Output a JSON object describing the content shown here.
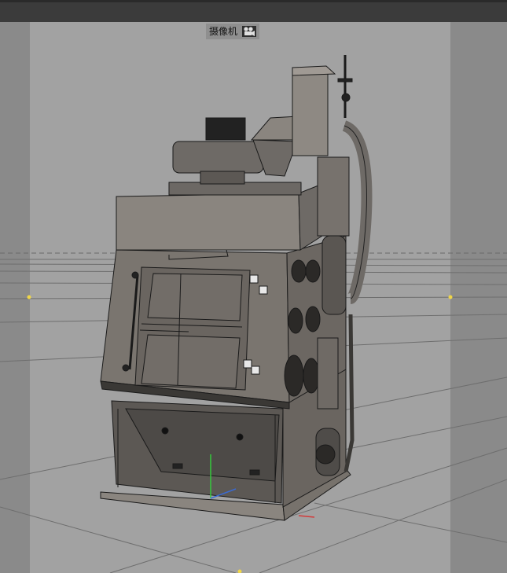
{
  "viewport": {
    "camera_label": "摄像机",
    "camera_icon": "camera-icon",
    "background": "#9a9a9a",
    "safe_frame_color": "#a4a4a4",
    "band_color": "#8a8a8a"
  },
  "scene": {
    "object": "industrial-shot-blasting-machine",
    "mesh_color": "#6e6a66",
    "wire_color": "#1a1a1a",
    "grid_color": "#6b6b6b",
    "axis_colors": {
      "y": "#34c93c",
      "x": "#d23a3a",
      "z": "#3a6ad2"
    },
    "marker_color": "#f0d648"
  }
}
